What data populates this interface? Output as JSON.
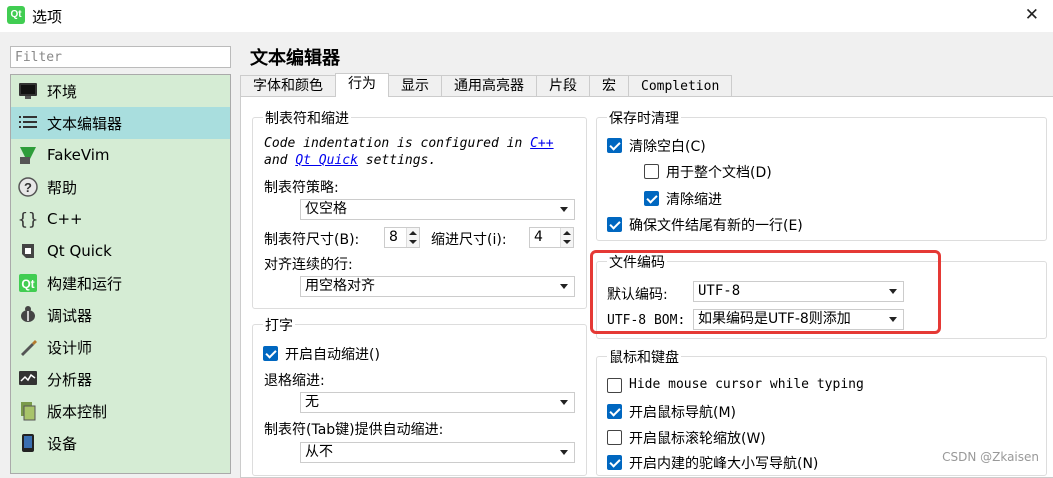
{
  "window": {
    "title": "选项",
    "app_icon_label": "Qt",
    "close_glyph": "✕"
  },
  "filter": {
    "placeholder": "Filter"
  },
  "sidebar": {
    "items": [
      {
        "label": "环境",
        "icon": "monitor-icon",
        "active": false
      },
      {
        "label": "文本编辑器",
        "icon": "text-editor-icon",
        "active": true
      },
      {
        "label": "FakeVim",
        "icon": "fakevim-icon",
        "active": false
      },
      {
        "label": "帮助",
        "icon": "help-icon",
        "active": false
      },
      {
        "label": "C++",
        "icon": "braces-icon",
        "active": false
      },
      {
        "label": "Qt Quick",
        "icon": "qtquick-icon",
        "active": false
      },
      {
        "label": "构建和运行",
        "icon": "build-run-icon",
        "active": false
      },
      {
        "label": "调试器",
        "icon": "debugger-icon",
        "active": false
      },
      {
        "label": "设计师",
        "icon": "designer-icon",
        "active": false
      },
      {
        "label": "分析器",
        "icon": "analyzer-icon",
        "active": false
      },
      {
        "label": "版本控制",
        "icon": "version-control-icon",
        "active": false
      },
      {
        "label": "设备",
        "icon": "device-icon",
        "active": false
      }
    ]
  },
  "main": {
    "heading": "文本编辑器",
    "tabs": [
      {
        "label": "字体和颜色",
        "active": false
      },
      {
        "label": "行为",
        "active": true
      },
      {
        "label": "显示",
        "active": false
      },
      {
        "label": "通用高亮器",
        "active": false
      },
      {
        "label": "片段",
        "active": false
      },
      {
        "label": "宏",
        "active": false
      },
      {
        "label": "Completion",
        "active": false
      }
    ]
  },
  "tabs_indent": {
    "title": "制表符和缩进",
    "note": {
      "part1": "Code indentation is configured in ",
      "link1": "C++",
      "part2": "and ",
      "link2": "Qt Quick",
      "part3": " settings."
    },
    "policy_label": "制表符策略:",
    "policy_value": "仅空格",
    "tab_size_label": "制表符尺寸(B):",
    "tab_size_value": "8",
    "indent_size_label": "缩进尺寸(i):",
    "indent_size_value": "4",
    "align_label": "对齐连续的行:",
    "align_value": "用空格对齐"
  },
  "typing": {
    "title": "打字",
    "auto_indent": {
      "label": "开启自动缩进()",
      "checked": true
    },
    "backspace_label": "退格缩进:",
    "backspace_value": "无",
    "tab_auto_label": "制表符(Tab键)提供自动缩进:",
    "tab_auto_value": "从不"
  },
  "cleanup": {
    "title": "保存时清理",
    "items": [
      {
        "label": "清除空白(C)",
        "checked": true
      },
      {
        "label": "用于整个文档(D)",
        "checked": false
      },
      {
        "label": "清除缩进",
        "checked": true
      },
      {
        "label": "确保文件结尾有新的一行(E)",
        "checked": true
      }
    ]
  },
  "encoding": {
    "title": "文件编码",
    "default_label": "默认编码:",
    "default_value": "UTF-8",
    "bom_label": "UTF-8 BOM:",
    "bom_value": "如果编码是UTF-8则添加",
    "highlight_color": "#e53935"
  },
  "mouse": {
    "title": "鼠标和键盘",
    "items": [
      {
        "label": "Hide mouse cursor while typing",
        "checked": false
      },
      {
        "label": "开启鼠标导航(M)",
        "checked": true
      },
      {
        "label": "开启鼠标滚轮缩放(W)",
        "checked": false
      },
      {
        "label": "开启内建的驼峰大小写导航(N)",
        "checked": true
      }
    ]
  },
  "watermark": "CSDN @Zkaisen",
  "colors": {
    "sidebar_bg": "#d5ecd4",
    "sidebar_active": "#a9dede",
    "checkbox_blue": "#0067c0"
  }
}
